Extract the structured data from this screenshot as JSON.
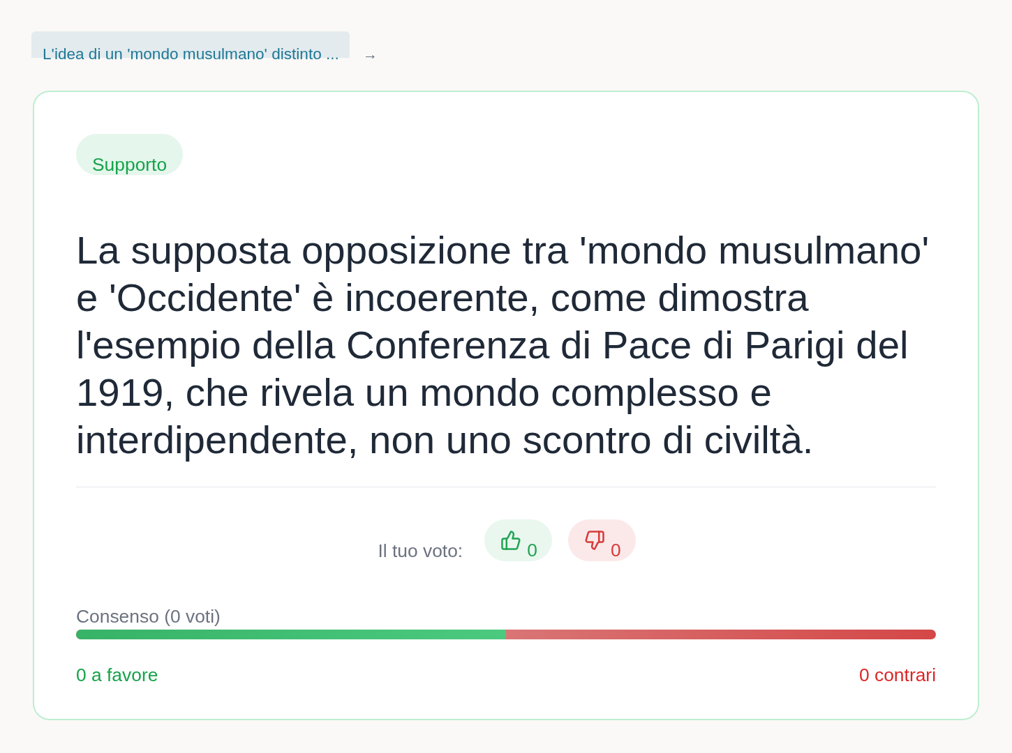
{
  "breadcrumb": {
    "link": "L'idea di un 'mondo musulmano' distinto ...",
    "arrow": "→"
  },
  "card": {
    "stance": {
      "kind": "support",
      "label": "Supporto"
    },
    "claim": "La supposta opposizione tra 'mondo musulmano' e 'Occidente' è incoerente, come dimostra l'esempio della Conferenza di Pace di Parigi del 1919, che rivela un mondo complesso e interdipendente, non uno scontro di civiltà.",
    "vote": {
      "label": "Il tuo voto:",
      "buttons": [
        {
          "kind": "up",
          "count": "0"
        },
        {
          "kind": "down",
          "count": "0"
        }
      ]
    },
    "consensus": {
      "label": "Consenso (0 voti)",
      "level": 0.5,
      "favor": "0 a favore",
      "against": "0 contrari"
    }
  }
}
